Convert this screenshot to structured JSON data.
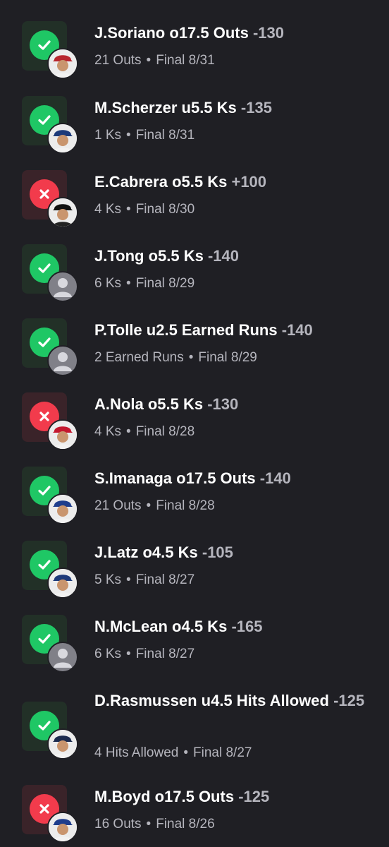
{
  "colors": {
    "background": "#1f1f24",
    "win_accent": "#1fc765",
    "loss_accent": "#f23b4c",
    "secondary_text": "#b5b5bd"
  },
  "separator": "•",
  "picks": [
    {
      "player": "J.Soriano",
      "line": "o17.5 Outs",
      "odds": "-130",
      "stat": "21 Outs",
      "status": "Final",
      "date": "8/31",
      "result": "win",
      "avatar": "player-headshot-angels"
    },
    {
      "player": "M.Scherzer",
      "line": "u5.5 Ks",
      "odds": "-135",
      "stat": "1 Ks",
      "status": "Final",
      "date": "8/31",
      "result": "win",
      "avatar": "player-headshot-rangers"
    },
    {
      "player": "E.Cabrera",
      "line": "o5.5 Ks",
      "odds": "+100",
      "stat": "4 Ks",
      "status": "Final",
      "date": "8/30",
      "result": "loss",
      "avatar": "player-headshot-marlins"
    },
    {
      "player": "J.Tong",
      "line": "o5.5 Ks",
      "odds": "-140",
      "stat": "6 Ks",
      "status": "Final",
      "date": "8/29",
      "result": "win",
      "avatar": "generic-user"
    },
    {
      "player": "P.Tolle",
      "line": "u2.5 Earned Runs",
      "odds": "-140",
      "stat": "2 Earned Runs",
      "status": "Final",
      "date": "8/29",
      "result": "win",
      "avatar": "generic-user"
    },
    {
      "player": "A.Nola",
      "line": "o5.5 Ks",
      "odds": "-130",
      "stat": "4 Ks",
      "status": "Final",
      "date": "8/28",
      "result": "loss",
      "avatar": "player-headshot-phillies"
    },
    {
      "player": "S.Imanaga",
      "line": "o17.5 Outs",
      "odds": "-140",
      "stat": "21 Outs",
      "status": "Final",
      "date": "8/28",
      "result": "win",
      "avatar": "player-headshot-cubs"
    },
    {
      "player": "J.Latz",
      "line": "o4.5 Ks",
      "odds": "-105",
      "stat": "5 Ks",
      "status": "Final",
      "date": "8/27",
      "result": "win",
      "avatar": "player-headshot-rangers"
    },
    {
      "player": "N.McLean",
      "line": "o4.5 Ks",
      "odds": "-165",
      "stat": "6 Ks",
      "status": "Final",
      "date": "8/27",
      "result": "win",
      "avatar": "generic-user"
    },
    {
      "player": "D.Rasmussen",
      "line": "u4.5 Hits Allowed",
      "odds": "-125",
      "stat": "4 Hits Allowed",
      "status": "Final",
      "date": "8/27",
      "result": "win",
      "avatar": "player-headshot-rays"
    },
    {
      "player": "M.Boyd",
      "line": "o17.5 Outs",
      "odds": "-125",
      "stat": "16 Outs",
      "status": "Final",
      "date": "8/26",
      "result": "loss",
      "avatar": "player-headshot-cubs"
    }
  ]
}
